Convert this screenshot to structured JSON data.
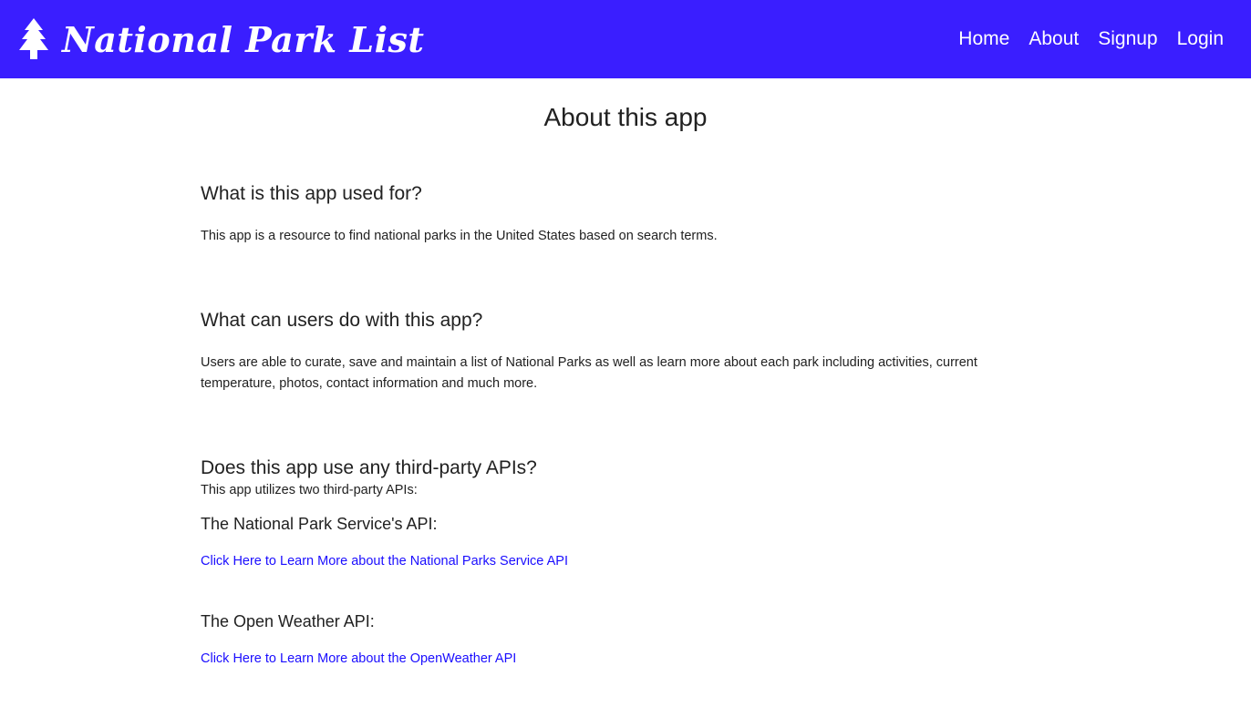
{
  "nav": {
    "brand": "National Park List",
    "brand_icon": "tree-icon",
    "links": [
      "Home",
      "About",
      "Signup",
      "Login"
    ]
  },
  "colors": {
    "navbar_bg": "#3a1eff",
    "link": "#1a0dff",
    "text": "#212121"
  },
  "page": {
    "title": "About this app"
  },
  "sections": {
    "purpose": {
      "heading": "What is this app used for?",
      "text": "This app is a resource to find national parks in the United States based on search terms."
    },
    "users": {
      "heading": "What can users do with this app?",
      "text": "Users are able to curate, save and maintain a list of National Parks as well as learn more about each park including activities, current temperature, photos, contact information and much more."
    },
    "apis": {
      "heading": "Does this app use any third-party APIs?",
      "intro": "This app utilizes two third-party APIs:",
      "items": [
        {
          "name": "The National Park Service's API:",
          "link_text": "Click Here to Learn More about the National Parks Service API"
        },
        {
          "name": "The Open Weather API:",
          "link_text": "Click Here to Learn More about the OpenWeather API"
        }
      ]
    }
  }
}
